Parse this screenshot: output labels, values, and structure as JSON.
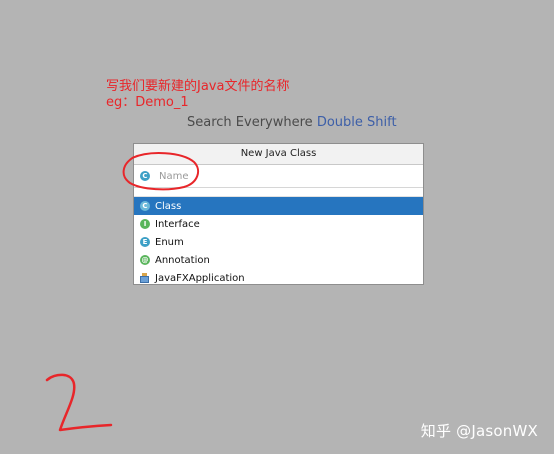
{
  "annotation": {
    "line1": "写我们要新建的Java文件的名称",
    "line2": "eg：Demo_1",
    "step_mark": "2"
  },
  "hint": {
    "text": "Search Everywhere",
    "shortcut": "Double Shift"
  },
  "dialog": {
    "title": "New Java Class",
    "name_placeholder": "Name",
    "name_value": "",
    "kinds": [
      {
        "label": "Class",
        "icon": "class-icon",
        "selected": true
      },
      {
        "label": "Interface",
        "icon": "interface-icon",
        "selected": false
      },
      {
        "label": "Enum",
        "icon": "enum-icon",
        "selected": false
      },
      {
        "label": "Annotation",
        "icon": "annotation-icon",
        "selected": false
      },
      {
        "label": "JavaFXApplication",
        "icon": "javafx-application-icon",
        "selected": false
      }
    ]
  },
  "watermark": "知乎 @JasonWX",
  "colors": {
    "background": "#b4b4b4",
    "selection": "#2675bf",
    "annotation_red": "#e8262a",
    "shortcut_blue": "#3d5fa8"
  }
}
